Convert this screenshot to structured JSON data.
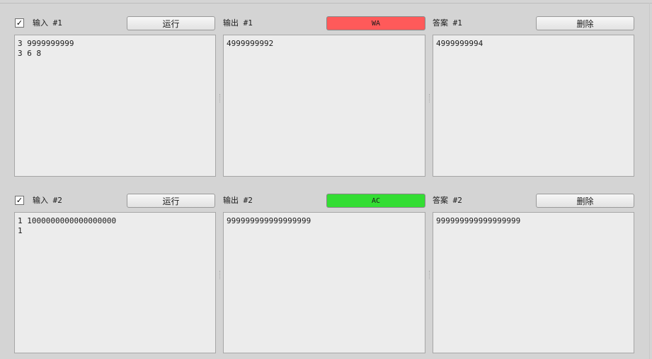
{
  "cases": [
    {
      "checked": true,
      "check_glyph": "✓",
      "input_label": "输入 #1",
      "run_label": "运行",
      "output_label": "输出 #1",
      "status": "WA",
      "status_color": "#ff5a5a",
      "answer_label": "答案 #1",
      "delete_label": "删除",
      "input_text": "3 9999999999\n3 6 8",
      "output_text": "4999999992",
      "answer_text": "4999999994"
    },
    {
      "checked": true,
      "check_glyph": "✓",
      "input_label": "输入 #2",
      "run_label": "运行",
      "output_label": "输出 #2",
      "status": "AC",
      "status_color": "#33dd33",
      "answer_label": "答案 #2",
      "delete_label": "删除",
      "input_text": "1 1000000000000000000\n1",
      "output_text": "999999999999999999",
      "answer_text": "999999999999999999"
    }
  ]
}
